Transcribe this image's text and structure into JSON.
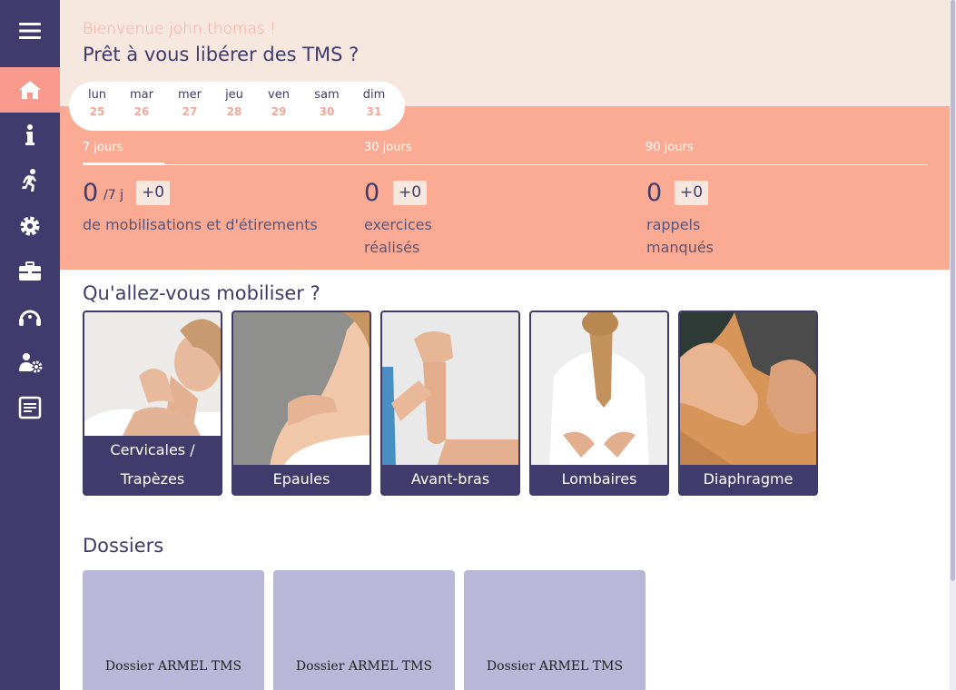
{
  "sidebar": {
    "items": [
      {
        "name": "menu-icon"
      },
      {
        "name": "home-icon",
        "active": true
      },
      {
        "name": "info-icon"
      },
      {
        "name": "running-icon"
      },
      {
        "name": "gear-icon"
      },
      {
        "name": "briefcase-icon"
      },
      {
        "name": "headset-icon"
      },
      {
        "name": "user-settings-icon"
      },
      {
        "name": "document-icon"
      }
    ]
  },
  "header": {
    "welcome": "Bienvenue john.thomas !",
    "headline": "Prêt à vous libérer des TMS ?"
  },
  "week": [
    {
      "day": "lun",
      "num": "25"
    },
    {
      "day": "mar",
      "num": "26"
    },
    {
      "day": "mer",
      "num": "27"
    },
    {
      "day": "jeu",
      "num": "28"
    },
    {
      "day": "ven",
      "num": "29"
    },
    {
      "day": "sam",
      "num": "30"
    },
    {
      "day": "dim",
      "num": "31"
    }
  ],
  "stats": [
    {
      "tab": "7 jours",
      "value": "0",
      "denom": "/7 j",
      "badge": "+0",
      "desc": "de mobilisations et d'étirements",
      "active": true
    },
    {
      "tab": "30 jours",
      "value": "0",
      "badge": "+0",
      "desc": "exercices réalisés"
    },
    {
      "tab": "90 jours",
      "value": "0",
      "badge": "+0",
      "desc": "rappels manqués"
    }
  ],
  "mobiliser": {
    "title": "Qu'allez-vous mobiliser ?",
    "cards": [
      {
        "label": "Cervicales / Trapèzes"
      },
      {
        "label": "Epaules"
      },
      {
        "label": "Avant-bras"
      },
      {
        "label": "Lombaires"
      },
      {
        "label": "Diaphragme"
      }
    ]
  },
  "dossiers": {
    "title": "Dossiers",
    "items": [
      {
        "label": "Dossier ARMEL TMS"
      },
      {
        "label": "Dossier ARMEL TMS"
      },
      {
        "label": "Dossier ARMEL TMS"
      }
    ]
  },
  "colors": {
    "sidebar": "#3f3b6c",
    "accent": "#f79a8c",
    "header_bg": "#f6e7df",
    "stats_bg": "#fbab93",
    "dossier_bg": "#b8b7d8"
  }
}
